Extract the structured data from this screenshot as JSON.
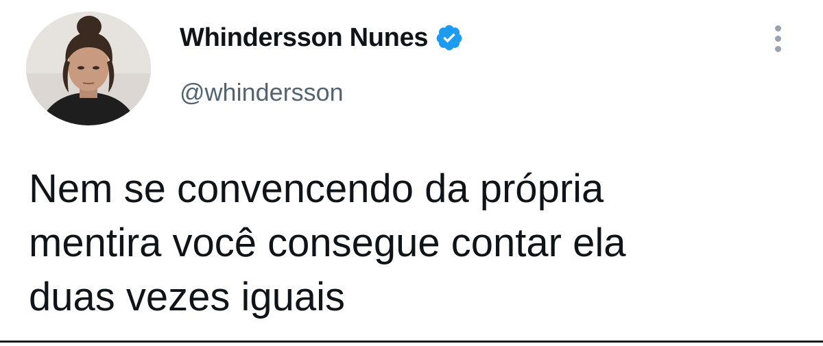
{
  "tweet": {
    "author": {
      "display_name": "Whindersson Nunes",
      "handle": "@whindersson",
      "verified": true,
      "avatar_icon": "profile-photo"
    },
    "text": "Nem se convencendo da própria\nmentira você consegue contar ela\nduas vezes iguais",
    "more_icon": "vertical-ellipsis-icon"
  },
  "colors": {
    "text_primary": "#0f1419",
    "text_secondary": "#536471",
    "verified_badge": "#1d9bf0",
    "background": "#ffffff"
  }
}
